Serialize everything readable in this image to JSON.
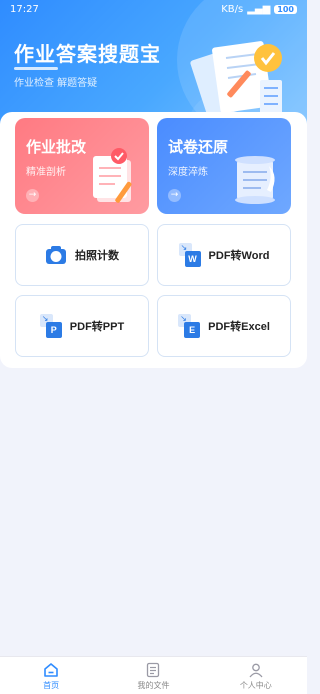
{
  "status_bar": {
    "time": "17:27",
    "right_text": "KB/s",
    "battery": "100"
  },
  "hero": {
    "title": "作业答案搜题宝",
    "subtitle": "作业检查 解题答疑"
  },
  "feature_cards": [
    {
      "title": "作业批改",
      "subtitle": "精准剖析",
      "arrow": "→"
    },
    {
      "title": "试卷还原",
      "subtitle": "深度淬炼",
      "arrow": "→"
    }
  ],
  "tools": [
    {
      "label": "拍照计数",
      "icon": "camera-icon",
      "badge": "5"
    },
    {
      "label": "PDF转Word",
      "icon": "pdf-to-word-icon",
      "badge": "W"
    },
    {
      "label": "PDF转PPT",
      "icon": "pdf-to-ppt-icon",
      "badge": "P"
    },
    {
      "label": "PDF转Excel",
      "icon": "pdf-to-excel-icon",
      "badge": "E"
    }
  ],
  "tabbar": [
    {
      "label": "首页",
      "icon": "home-icon",
      "active": true
    },
    {
      "label": "我的文件",
      "icon": "file-icon",
      "active": false
    },
    {
      "label": "个人中心",
      "icon": "user-icon",
      "active": false
    }
  ],
  "colors": {
    "accent": "#2f8cff",
    "red_card": "#ff7a82",
    "blue_card": "#4a8cff"
  }
}
